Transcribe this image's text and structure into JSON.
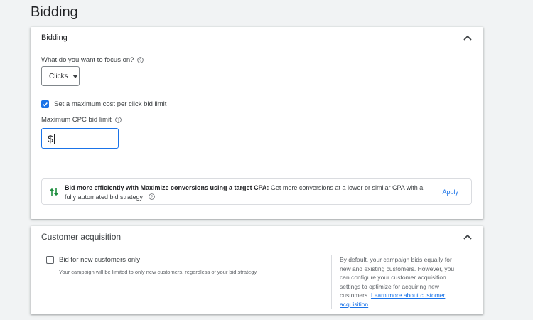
{
  "page": {
    "title": "Bidding"
  },
  "bidding_card": {
    "header": "Bidding",
    "focus_question": "What do you want to focus on?",
    "focus_selected": "Clicks",
    "max_cpc_checkbox_label": "Set a maximum cost per click bid limit",
    "max_cpc_checkbox_checked": true,
    "max_cpc_field_label": "Maximum CPC bid limit",
    "max_cpc_value": "$",
    "recommendation": {
      "bold": "Bid more efficiently with Maximize conversions using a target CPA:",
      "text": " Get more conversions at a lower or similar CPA with a fully automated bid strategy",
      "apply_label": "Apply"
    }
  },
  "customer_card": {
    "header": "Customer acquisition",
    "checkbox_label": "Bid for new customers only",
    "checkbox_checked": false,
    "sub_text": "Your campaign will be limited to only new customers, regardless of your bid strategy",
    "info_text": "By default, your campaign bids equally for new and existing customers. However, you can configure your customer acquisition settings to optimize for acquiring new customers. ",
    "info_link": "Learn more about customer acquisition"
  },
  "colors": {
    "accent": "#1a73e8",
    "background": "#f1f3f4",
    "card": "#ffffff",
    "green_icon": "#1e8e3e"
  },
  "icons": [
    "chevron-up-icon",
    "help-icon",
    "caret-down-icon",
    "check-icon",
    "bid-strategy-icon"
  ]
}
